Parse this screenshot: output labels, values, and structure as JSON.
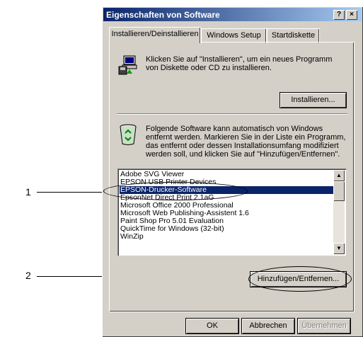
{
  "dialog": {
    "title": "Eigenschaften von Software",
    "help_label": "?",
    "close_label": "×"
  },
  "tabs": [
    {
      "label": "Installieren/Deinstallieren"
    },
    {
      "label": "Windows Setup"
    },
    {
      "label": "Startdiskette"
    }
  ],
  "install": {
    "description": "Klicken Sie auf \"Installieren\", um ein neues Programm von Diskette oder CD zu installieren.",
    "button_label": "Installieren...",
    "icon": "installer-computer-icon"
  },
  "uninstall": {
    "description": "Folgende Software kann automatisch von Windows entfernt werden. Markieren Sie in der Liste ein Programm, das entfernt oder dessen Installationsumfang modifiziert werden soll, und klicken Sie auf \"Hinzufügen/Entfernen\".",
    "icon": "recycle-bin-icon"
  },
  "software_list": {
    "items": [
      "Adobe SVG Viewer",
      "EPSON USB Printer Devices",
      "EPSON-Drucker-Software",
      "EpsonNet Direct Print 2.1aG",
      "Microsoft Office 2000 Professional",
      "Microsoft Web Publishing-Assistent 1.6",
      "Paint Shop Pro 5.01 Evaluation",
      "QuickTime for Windows (32-bit)",
      "WinZip"
    ],
    "selected_index": 2
  },
  "add_remove_button": "Hinzufügen/Entfernen...",
  "footer": {
    "ok_label": "OK",
    "cancel_label": "Abbrechen",
    "apply_label": "Übernehmen"
  },
  "callouts": {
    "one": "1",
    "two": "2"
  }
}
